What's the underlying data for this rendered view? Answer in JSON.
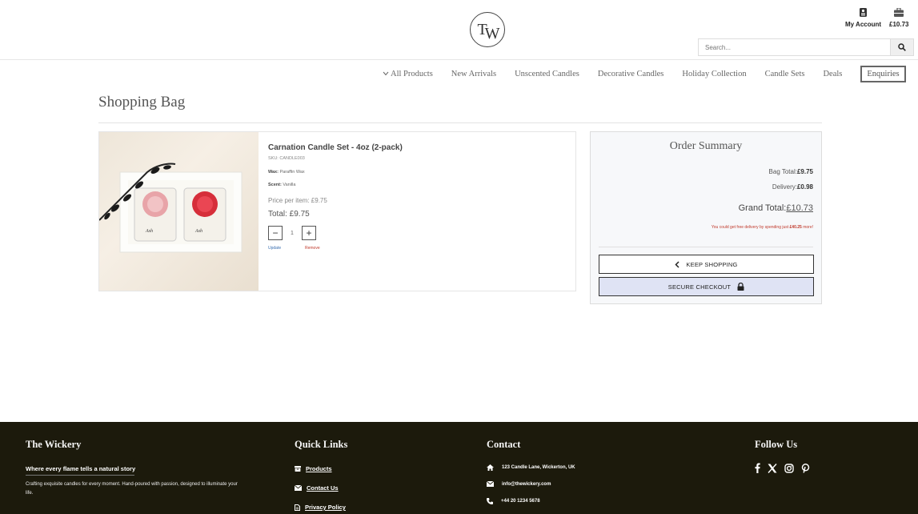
{
  "header": {
    "logo_text_t": "T",
    "logo_text_w": "W",
    "account_label": "My Account",
    "bag_total": "£10.73",
    "search_placeholder": "Search..."
  },
  "nav": {
    "items": [
      "All Products",
      "New Arrivals",
      "Unscented Candles",
      "Decorative Candles",
      "Holiday Collection",
      "Candle Sets",
      "Deals",
      "Enquiries"
    ]
  },
  "page_title": "Shopping Bag",
  "product": {
    "name": "Carnation Candle Set - 4oz (2-pack)",
    "sku": "SKU: CANDLE003",
    "wax_label": "Wax:",
    "wax_value": "Paraffin Wax",
    "scent_label": "Scent:",
    "scent_value": "Vanilla",
    "price_per_item": "Price per item: £9.75",
    "total": "Total: £9.75",
    "quantity": "1",
    "minus": "−",
    "plus": "+",
    "update": "Update",
    "remove": "Remove"
  },
  "summary": {
    "title": "Order Summary",
    "bag_total_label": "Bag Total:",
    "bag_total_value": "£9.75",
    "delivery_label": "Delivery:",
    "delivery_value": "£0.98",
    "grand_total_label": "Grand Total:",
    "grand_total_value": "£10.73",
    "free_delivery_prefix": "You could get free delivery by spending just ",
    "free_delivery_amount": "£40.25",
    "free_delivery_suffix": " more!",
    "keep_shopping": "KEEP SHOPPING",
    "secure_checkout": "SECURE CHECKOUT"
  },
  "footer": {
    "brand": "The Wickery",
    "tagline": "Where every flame tells a natural story",
    "description": "Crafting exquisite candles for every moment. Hand-poured with passion, designed to illuminate your life.",
    "quick_links_title": "Quick Links",
    "quick_links": [
      "Products",
      "Contact Us",
      "Privacy Policy"
    ],
    "contact_title": "Contact",
    "address": "123 Candle Lane, Wickerton, UK",
    "email": "info@thewickery.com",
    "phone": "+44 20 1234 5678",
    "follow_title": "Follow Us",
    "social_icons": [
      "facebook-icon",
      "x-icon",
      "instagram-icon",
      "pinterest-icon"
    ]
  },
  "colors": {
    "footer_bg": "#1c1a0c",
    "checkout_bg": "#dfe3f4",
    "remove_red": "#c0392b",
    "update_blue": "#3a6fb0"
  }
}
